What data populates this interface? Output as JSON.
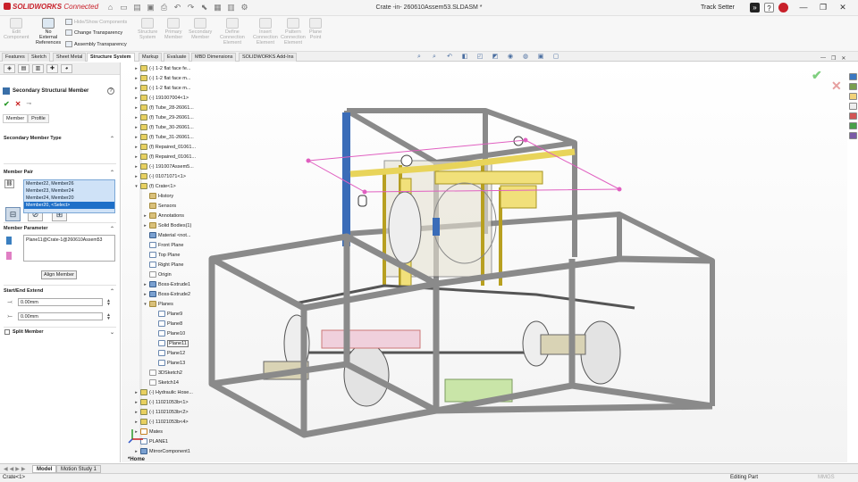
{
  "app": {
    "brand": "SOLIDWORKS",
    "brand_suffix": "Connected",
    "doc_title": "Crate -in- 260610Assem53.SLDASM *",
    "user": "Track Setter"
  },
  "ribbon": {
    "buttons": [
      {
        "label": "Edit\nComponent",
        "enabled": false
      },
      {
        "label": "No\nExternal\nReferences",
        "enabled": true
      },
      {
        "label": "Structure\nSystem",
        "enabled": false
      },
      {
        "label": "Primary\nMember",
        "enabled": false
      },
      {
        "label": "Secondary\nMember",
        "enabled": false
      },
      {
        "label": "Define\nConnection\nElement",
        "enabled": false
      },
      {
        "label": "Insert\nConnection\nElement",
        "enabled": false
      },
      {
        "label": "Pattern\nConnection\nElement",
        "enabled": false
      },
      {
        "label": "Plane\nPoint",
        "enabled": false
      }
    ],
    "small": {
      "hide_show": "Hide/Show Components",
      "change_transparency": "Change Transparency",
      "assembly_transparency": "Assembly Transparency"
    }
  },
  "tabs": [
    "Features",
    "Sketch",
    "Sheet Metal",
    "Structure System",
    "Markup",
    "Evaluate",
    "MBD Dimensions",
    "SOLIDWORKS Add-Ins"
  ],
  "active_tab": "Structure System",
  "property_manager": {
    "title": "Secondary Structural Member",
    "subtabs": [
      "Member",
      "Profile"
    ],
    "active_subtab": "Member",
    "sections": {
      "type": "Secondary Member Type",
      "member_pair": "Member Pair",
      "member_parameter": "Member Parameter",
      "start_end": "Start/End Extend",
      "split": "Split Member"
    },
    "member_pairs": [
      {
        "text": "Member22, Member26",
        "selected": false
      },
      {
        "text": "Member23, Member24",
        "selected": false
      },
      {
        "text": "Member24, Member20",
        "selected": false
      },
      {
        "text": "Member20, <Select>",
        "selected": true
      }
    ],
    "parameter_value": "Plane11@Crate-1@260610Assem53",
    "align_button": "Align Member",
    "start_extend": "0.00mm",
    "end_extend": "0.00mm"
  },
  "tree": [
    {
      "label": "(-) 1-2 flat face fe...",
      "icon": "part",
      "indent": 0,
      "arrow": ">"
    },
    {
      "label": "(-) 1-2 flat face m...",
      "icon": "part",
      "indent": 0,
      "arrow": ">"
    },
    {
      "label": "(-) 1-2 flat face m...",
      "icon": "part",
      "indent": 0,
      "arrow": ">"
    },
    {
      "label": "(-) 191007004<1>",
      "icon": "part",
      "indent": 0,
      "arrow": ">"
    },
    {
      "label": "(f) Tube_28-26061...",
      "icon": "part",
      "indent": 0,
      "arrow": ">"
    },
    {
      "label": "(f) Tube_29-26061...",
      "icon": "part",
      "indent": 0,
      "arrow": ">"
    },
    {
      "label": "(f) Tube_30-26061...",
      "icon": "part",
      "indent": 0,
      "arrow": ">"
    },
    {
      "label": "(f) Tube_31-26061...",
      "icon": "part",
      "indent": 0,
      "arrow": ">"
    },
    {
      "label": "(f) Repaired_01061...",
      "icon": "part",
      "indent": 0,
      "arrow": ">"
    },
    {
      "label": "(f) Repaired_01061...",
      "icon": "part",
      "indent": 0,
      "arrow": ">"
    },
    {
      "label": "(-) 191007Assem5...",
      "icon": "part",
      "indent": 0,
      "arrow": ">"
    },
    {
      "label": "(-) 01071071<1>",
      "icon": "part",
      "indent": 0,
      "arrow": ">"
    },
    {
      "label": "(f) Crate<1>",
      "icon": "part",
      "indent": 0,
      "arrow": "v"
    },
    {
      "label": "History",
      "icon": "folder",
      "indent": 1,
      "arrow": ""
    },
    {
      "label": "Sensors",
      "icon": "folder",
      "indent": 1,
      "arrow": ""
    },
    {
      "label": "Annotations",
      "icon": "folder",
      "indent": 1,
      "arrow": ">"
    },
    {
      "label": "Solid Bodies(1)",
      "icon": "folder",
      "indent": 1,
      "arrow": ">"
    },
    {
      "label": "Material <not...",
      "icon": "feat",
      "indent": 1,
      "arrow": ""
    },
    {
      "label": "Front Plane",
      "icon": "plane",
      "indent": 1,
      "arrow": ""
    },
    {
      "label": "Top Plane",
      "icon": "plane",
      "indent": 1,
      "arrow": ""
    },
    {
      "label": "Right Plane",
      "icon": "plane",
      "indent": 1,
      "arrow": ""
    },
    {
      "label": "Origin",
      "icon": "sk",
      "indent": 1,
      "arrow": ""
    },
    {
      "label": "Boss-Extrude1",
      "icon": "feat",
      "indent": 1,
      "arrow": ">"
    },
    {
      "label": "Boss-Extrude2",
      "icon": "feat",
      "indent": 1,
      "arrow": ">"
    },
    {
      "label": "Planes",
      "icon": "folder",
      "indent": 1,
      "arrow": "v"
    },
    {
      "label": "Plane9",
      "icon": "plane",
      "indent": 2,
      "arrow": ""
    },
    {
      "label": "Plane8",
      "icon": "plane",
      "indent": 2,
      "arrow": ""
    },
    {
      "label": "Plane10",
      "icon": "plane",
      "indent": 2,
      "arrow": ""
    },
    {
      "label": "Plane11",
      "icon": "plane",
      "indent": 2,
      "arrow": "",
      "boxed": true
    },
    {
      "label": "Plane12",
      "icon": "plane",
      "indent": 2,
      "arrow": ""
    },
    {
      "label": "Plane13",
      "icon": "plane",
      "indent": 2,
      "arrow": ""
    },
    {
      "label": "3DSketch2",
      "icon": "sk",
      "indent": 1,
      "arrow": ""
    },
    {
      "label": "Sketch14",
      "icon": "sk",
      "indent": 1,
      "arrow": ""
    },
    {
      "label": "(-) Hydraulic Hose...",
      "icon": "part",
      "indent": 0,
      "arrow": ">"
    },
    {
      "label": "(-) 11021053b<1>",
      "icon": "part",
      "indent": 0,
      "arrow": ">"
    },
    {
      "label": "(-) 11021053b<2>",
      "icon": "part",
      "indent": 0,
      "arrow": ">"
    },
    {
      "label": "(-) 11021053b<4>",
      "icon": "part",
      "indent": 0,
      "arrow": ">"
    },
    {
      "label": "Mates",
      "icon": "mate",
      "indent": 0,
      "arrow": ">"
    },
    {
      "label": "PLANE1",
      "icon": "plane",
      "indent": 0,
      "arrow": ""
    },
    {
      "label": "MirrorComponent1",
      "icon": "feat",
      "indent": 0,
      "arrow": ">"
    }
  ],
  "bottom_tabs": [
    "Model",
    "Motion Study 1"
  ],
  "active_bottom_tab": "Model",
  "home_label": "*Home",
  "status": {
    "left": "Crate<1>",
    "editing": "Editing Part",
    "units": "MMGS"
  },
  "colors": {
    "accent_red": "#c8202a",
    "selection_blue": "#1e6fc8",
    "frame_gray": "#8c8c8c",
    "plane_pink": "#e05fc0"
  }
}
